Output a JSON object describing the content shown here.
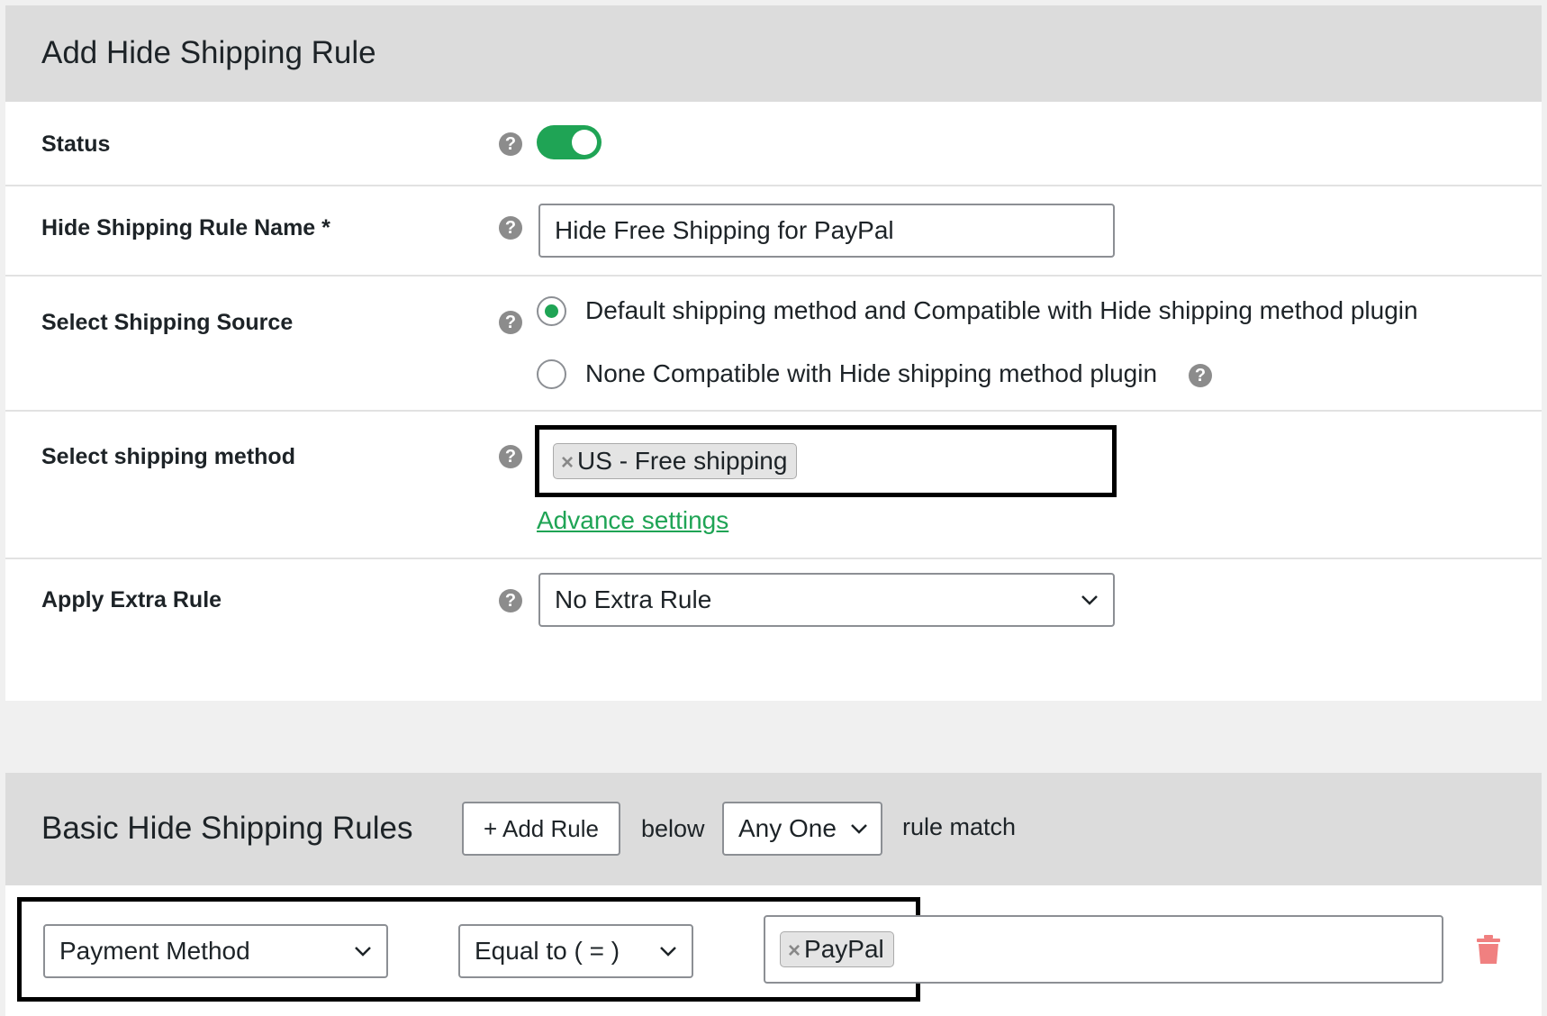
{
  "rule_panel": {
    "title": "Add Hide Shipping Rule",
    "help_symbol": "?",
    "status": {
      "label": "Status",
      "enabled": true
    },
    "rule_name": {
      "label": "Hide Shipping Rule Name *",
      "value": "Hide Free Shipping for PayPal"
    },
    "shipping_source": {
      "label": "Select Shipping Source",
      "options": [
        {
          "label": "Default shipping method and Compatible with Hide shipping method plugin",
          "selected": true
        },
        {
          "label": "None Compatible with Hide shipping method plugin",
          "selected": false
        }
      ]
    },
    "shipping_method": {
      "label": "Select shipping method",
      "chips": [
        "US - Free shipping"
      ],
      "chip_remove": "×",
      "advance_link": "Advance settings"
    },
    "extra_rule": {
      "label": "Apply Extra Rule",
      "selected": "No Extra Rule"
    }
  },
  "rules_panel": {
    "title": "Basic Hide Shipping Rules",
    "add_rule_label": "+ Add Rule",
    "below_text": "below",
    "match_select": "Any One",
    "rule_match_text": "rule match",
    "condition": {
      "field": "Payment Method",
      "operator": "Equal to ( = )",
      "value_chips": [
        "PayPal"
      ],
      "chip_remove": "×"
    }
  },
  "colors": {
    "accent_green": "#1fa455",
    "header_gray": "#dcdcdc",
    "trash_red": "#f08080"
  }
}
